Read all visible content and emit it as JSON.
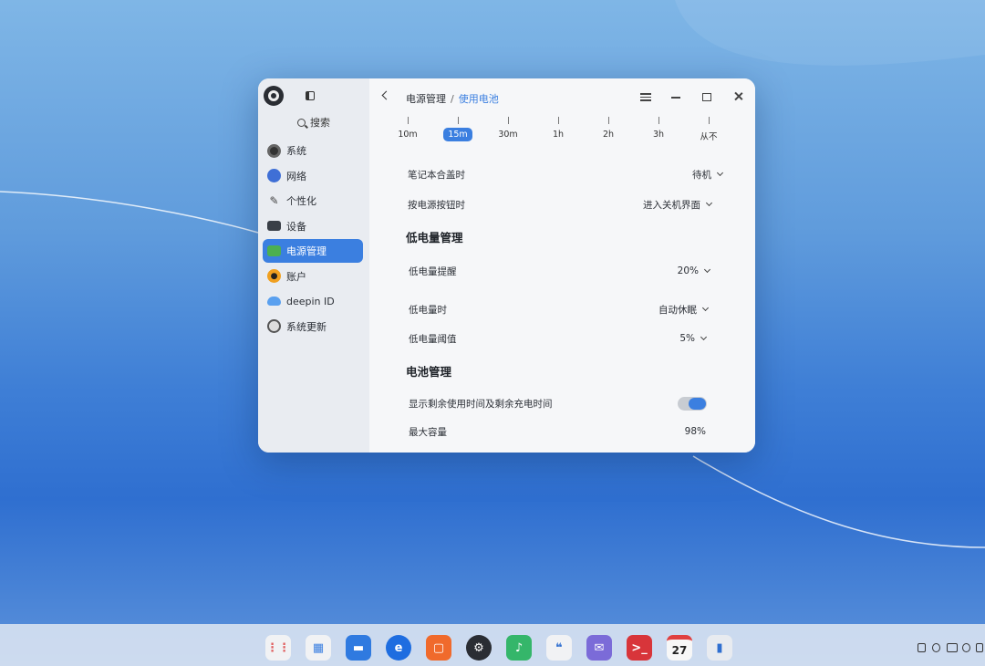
{
  "sidebar": {
    "search_label": "搜索",
    "items": [
      {
        "label": "系统"
      },
      {
        "label": "网络"
      },
      {
        "label": "个性化"
      },
      {
        "label": "设备"
      },
      {
        "label": "电源管理"
      },
      {
        "label": "账户"
      },
      {
        "label": "deepin ID"
      },
      {
        "label": "系统更新"
      }
    ],
    "active_index": 4
  },
  "header": {
    "breadcrumb_parent": "电源管理",
    "breadcrumb_separator": "/",
    "breadcrumb_current": "使用电池"
  },
  "slider": {
    "ticks": [
      "10m",
      "15m",
      "30m",
      "1h",
      "2h",
      "3h",
      "从不"
    ],
    "selected": "15m"
  },
  "settings": {
    "lid_close_label": "笔记本合盖时",
    "lid_close_value": "待机",
    "power_button_label": "按电源按钮时",
    "power_button_value": "进入关机界面"
  },
  "low_battery": {
    "title": "低电量管理",
    "warning_label": "低电量提醒",
    "warning_value": "20%",
    "action_label": "低电量时",
    "action_value": "自动休眠",
    "threshold_label": "低电量阈值",
    "threshold_value": "5%"
  },
  "battery": {
    "title": "电池管理",
    "show_time_label": "显示剩余使用时间及剩余充电时间",
    "show_time_enabled": true,
    "capacity_label": "最大容量",
    "capacity_value": "98%"
  },
  "dock": {
    "calendar_day": "27",
    "icons": [
      "launcher-icon",
      "multitask-icon",
      "file-manager-icon",
      "browser-icon",
      "app-store-icon",
      "settings-icon",
      "music-icon",
      "quote-icon",
      "mail-icon",
      "terminal-icon",
      "calendar-icon",
      "phone-icon"
    ]
  },
  "colors": {
    "accent": "#3b7fe0"
  }
}
